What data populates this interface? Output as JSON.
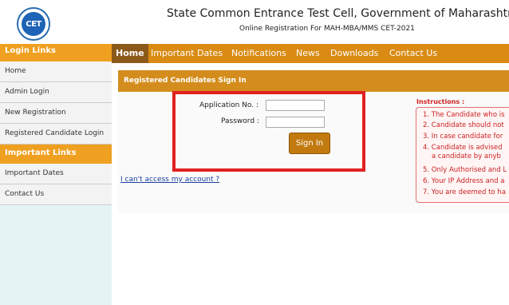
{
  "header": {
    "logo_text": "CET",
    "title": "State Common Entrance Test Cell, Government of Maharashtra",
    "subtitle": "Online Registration For MAH-MBA/MMS CET-2021"
  },
  "sidebar": {
    "login_heading": "Login Links",
    "login_items": [
      "Home",
      "Admin Login",
      "New Registration",
      "Registered Candidate Login"
    ],
    "important_heading": "Important Links",
    "important_items": [
      "Important Dates",
      "Contact Us"
    ]
  },
  "nav": {
    "items": [
      "Home",
      "Important Dates",
      "Notifications",
      "News",
      "Downloads",
      "Contact Us"
    ],
    "active": "Home"
  },
  "signin": {
    "panel_title": "Registered Candidates Sign In",
    "application_label": "Application No. :",
    "application_value": "",
    "password_label": "Password :",
    "password_value": "",
    "button_label": "Sign In",
    "cant_access": "I can't access my account ?"
  },
  "instructions": {
    "title": "Instructions :",
    "items": [
      "1. The Candidate who is",
      "2. Candidate should not",
      "3. In case candidate for",
      "4. Candidate is advised",
      "a candidate by anyb",
      "5. Only Authorised and L",
      "6. Your IP Address and a",
      "7. You are deemed to ha"
    ]
  },
  "colors": {
    "nav_bg": "#d98b14",
    "nav_active": "#8b5a1a",
    "accent": "#f0a020",
    "highlight": "#e02020",
    "instructions": "#cc2222"
  }
}
